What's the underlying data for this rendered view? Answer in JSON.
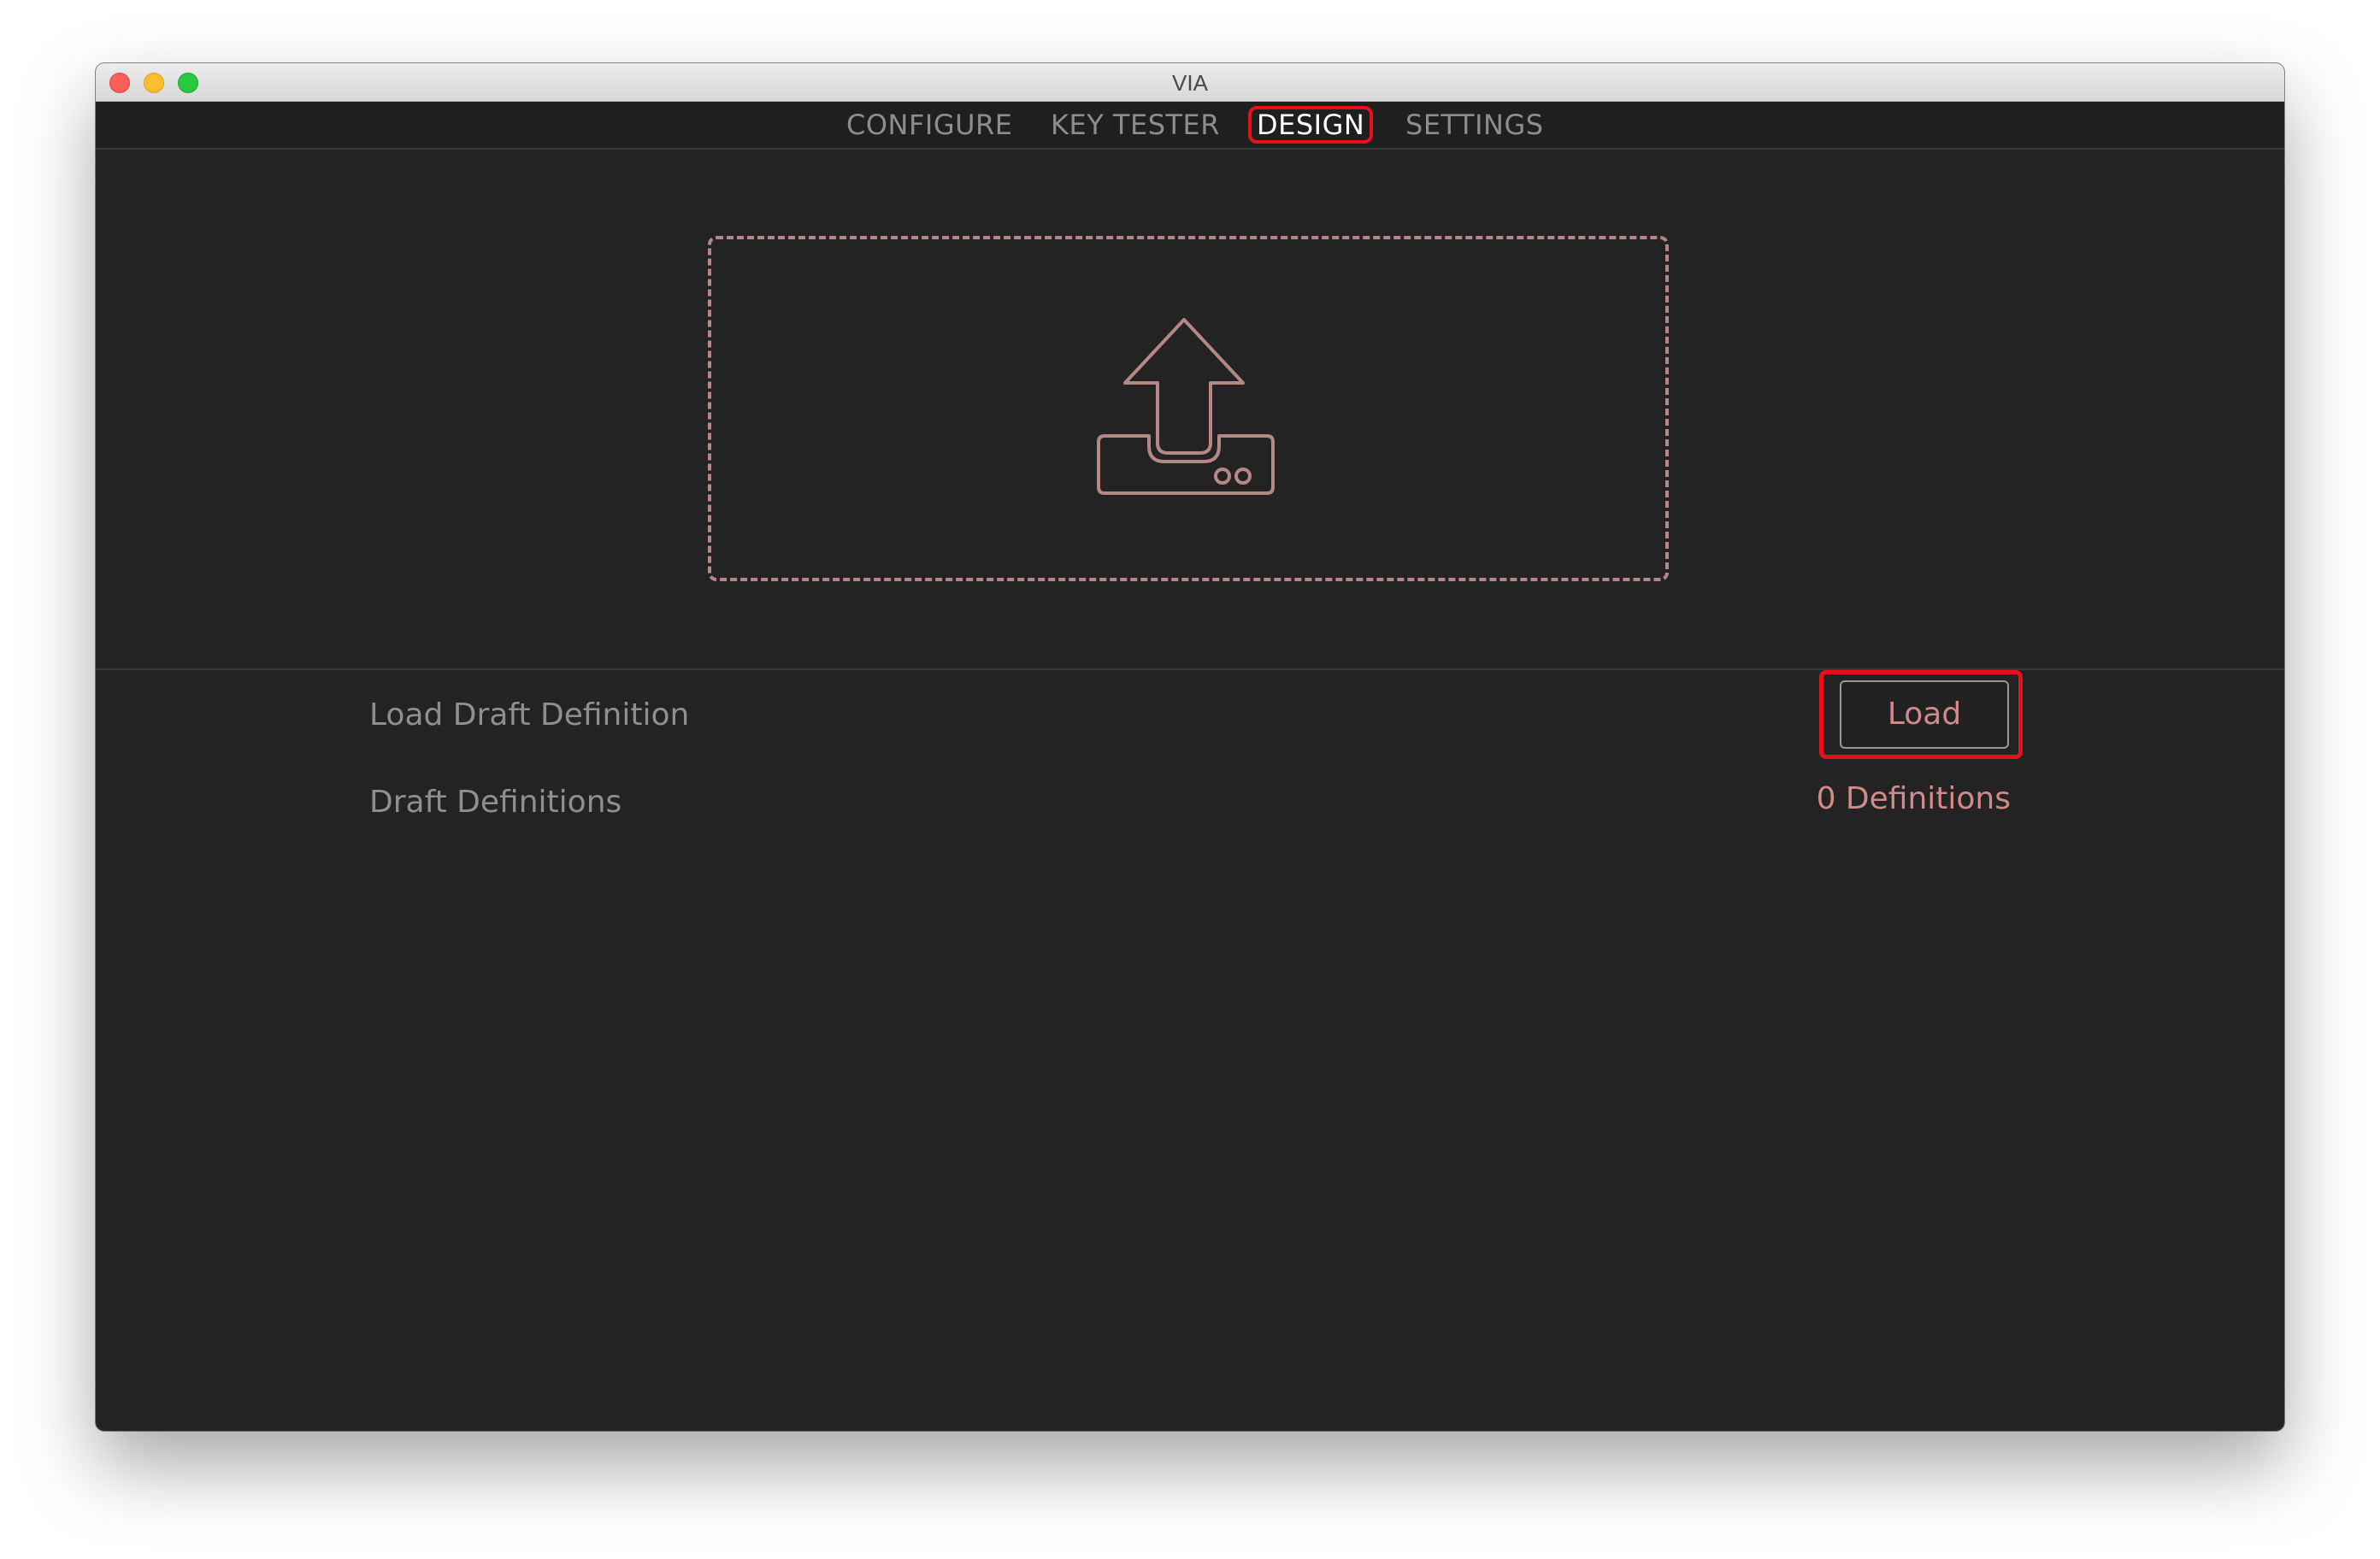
{
  "window": {
    "title": "VIA"
  },
  "nav": {
    "tabs": [
      {
        "label": "CONFIGURE",
        "active": false
      },
      {
        "label": "KEY TESTER",
        "active": false
      },
      {
        "label": "DESIGN",
        "active": true
      },
      {
        "label": "SETTINGS",
        "active": false
      }
    ]
  },
  "dropzone": {
    "icon": "upload-tray-icon"
  },
  "settings": {
    "rows": [
      {
        "label": "Load Draft Definition",
        "control_label": "Load"
      },
      {
        "label": "Draft Definitions",
        "value": "0 Definitions"
      }
    ]
  },
  "colors": {
    "background": "#232323",
    "accent": "#d08a8a",
    "highlight": "#e8101a",
    "text_muted": "#8f8f8f"
  }
}
